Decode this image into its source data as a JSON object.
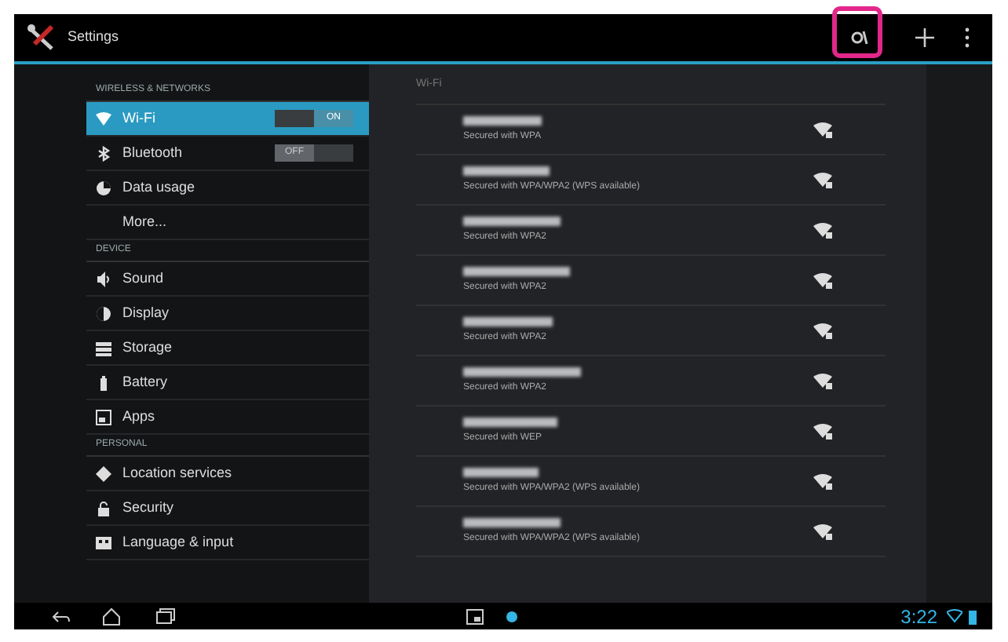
{
  "action_bar": {
    "title": "Settings"
  },
  "sidebar": {
    "items": [
      {
        "kind": "header",
        "label": "WIRELESS & NETWORKS"
      },
      {
        "kind": "item",
        "label": "Wi-Fi",
        "selected": true,
        "toggle": {
          "on": true,
          "label": "ON"
        }
      },
      {
        "kind": "item",
        "label": "Bluetooth",
        "selected": false,
        "toggle": {
          "on": false,
          "label": "OFF"
        }
      },
      {
        "kind": "item",
        "label": "Data usage",
        "selected": false
      },
      {
        "kind": "item",
        "label": "More...",
        "selected": false
      },
      {
        "kind": "header",
        "label": "DEVICE"
      },
      {
        "kind": "item",
        "label": "Sound",
        "selected": false
      },
      {
        "kind": "item",
        "label": "Display",
        "selected": false
      },
      {
        "kind": "item",
        "label": "Storage",
        "selected": false
      },
      {
        "kind": "item",
        "label": "Battery",
        "selected": false
      },
      {
        "kind": "item",
        "label": "Apps",
        "selected": false
      },
      {
        "kind": "header",
        "label": "PERSONAL"
      },
      {
        "kind": "item",
        "label": "Location services",
        "selected": false
      },
      {
        "kind": "item",
        "label": "Security",
        "selected": false
      },
      {
        "kind": "item",
        "label": "Language & input",
        "selected": false
      }
    ]
  },
  "wifi_panel": {
    "header": "Wi-Fi",
    "networks": [
      {
        "security": "Secured with WPA"
      },
      {
        "security": "Secured with WPA/WPA2 (WPS available)"
      },
      {
        "security": "Secured with WPA2"
      },
      {
        "security": "Secured with WPA2"
      },
      {
        "security": "Secured with WPA2"
      },
      {
        "security": "Secured with WPA2"
      },
      {
        "security": "Secured with WEP"
      },
      {
        "security": "Secured with WPA/WPA2 (WPS available)"
      },
      {
        "security": "Secured with WPA/WPA2 (WPS available)"
      }
    ]
  },
  "status_bar": {
    "time": "3:22"
  }
}
